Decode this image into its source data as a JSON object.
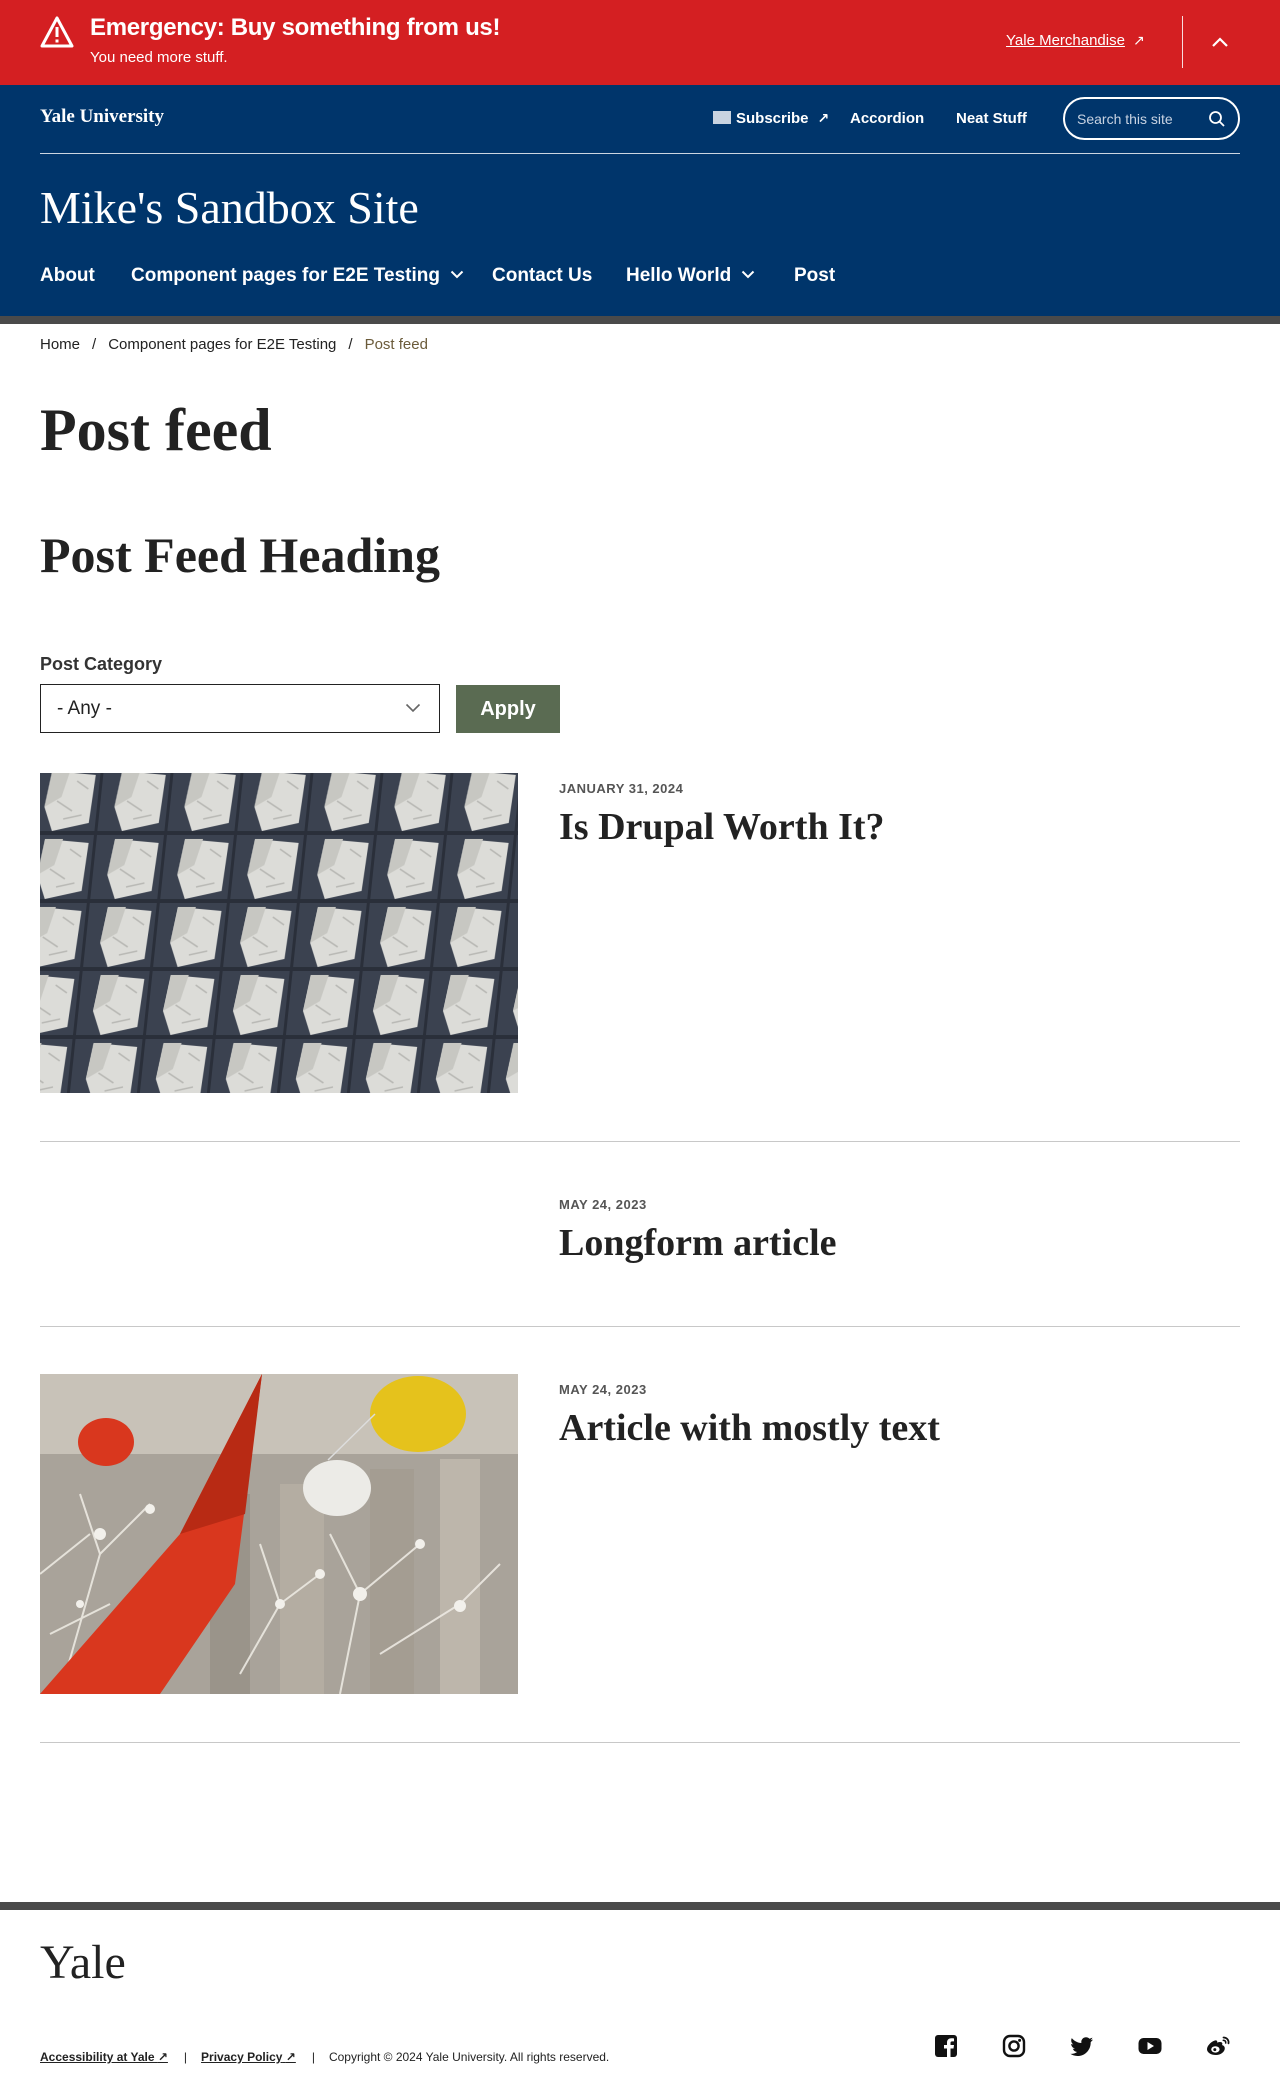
{
  "alert": {
    "title": "Emergency: Buy something from us!",
    "subtitle": "You need more stuff.",
    "link": "Yale Merchandise",
    "color": "#d41f22"
  },
  "header": {
    "org": "Yale University",
    "utility": {
      "subscribe": "Subscribe",
      "accordion": "Accordion",
      "neat": "Neat Stuff"
    },
    "search_placeholder": "Search this site",
    "site_title": "Mike's Sandbox Site",
    "nav": [
      "About",
      "Component pages for E2E Testing",
      "Contact Us",
      "Hello World",
      "Post"
    ],
    "color": "#00356b"
  },
  "breadcrumb": [
    "Home",
    "Component pages for E2E Testing",
    "Post feed"
  ],
  "page_title": "Post feed",
  "feed_heading": "Post Feed Heading",
  "filter": {
    "label": "Post Category",
    "selected": "- Any -",
    "apply": "Apply",
    "apply_color": "#5a6b52"
  },
  "posts": [
    {
      "date": "JANUARY 31, 2024",
      "title": "Is Drupal Worth It?",
      "image": "marble-facade"
    },
    {
      "date": "MAY 24, 2023",
      "title": "Longform article",
      "image": ""
    },
    {
      "date": "MAY 24, 2023",
      "title": "Article with mostly text",
      "image": "red-sculpture-snow"
    }
  ],
  "footer": {
    "logo": "Yale",
    "links": [
      "Accessibility at Yale",
      "Privacy Policy"
    ],
    "copyright": "Copyright © 2024 Yale University. All rights reserved.",
    "social_icons": [
      "facebook-icon",
      "instagram-icon",
      "twitter-icon",
      "youtube-icon",
      "weibo-icon"
    ]
  }
}
